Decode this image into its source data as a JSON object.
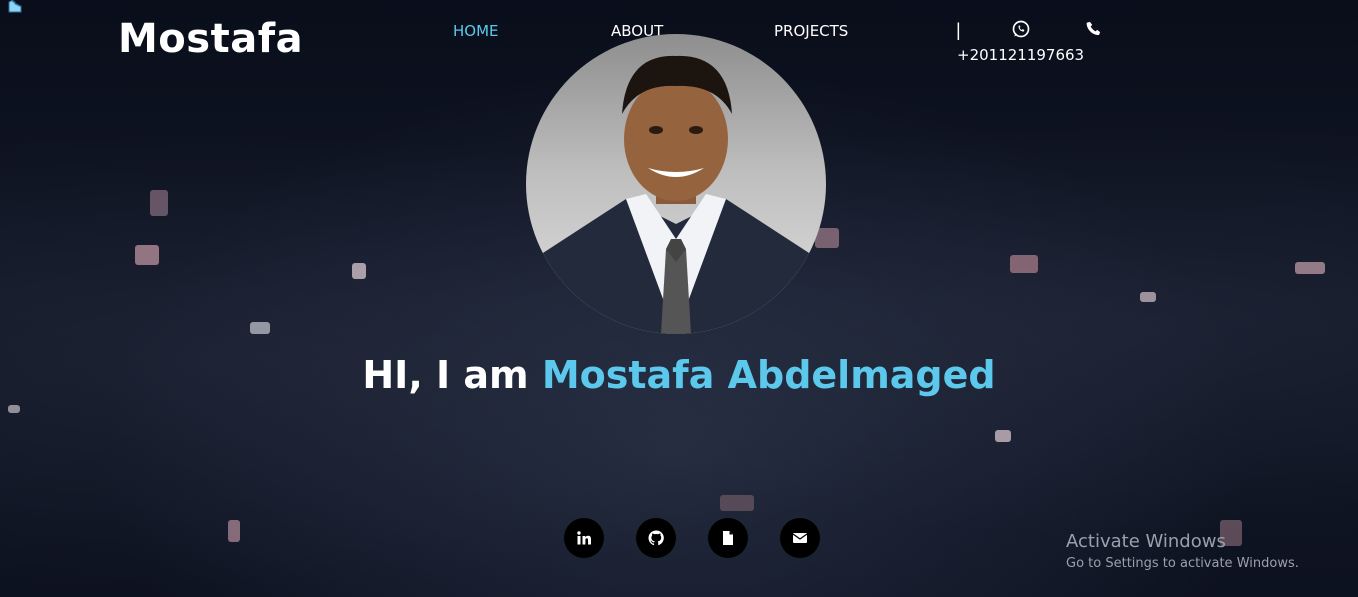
{
  "brand": {
    "name": "Mostafa"
  },
  "nav": {
    "items": [
      {
        "label": "HOME",
        "active": true
      },
      {
        "label": "ABOUT",
        "active": false
      },
      {
        "label": "PROJECTS",
        "active": false
      }
    ],
    "separator": "|",
    "phone_number": "+201121197663",
    "icons": [
      "whatsapp-icon",
      "phone-icon"
    ]
  },
  "hero": {
    "greeting": "HI, I am ",
    "name": "Mostafa Abdelmaged",
    "avatar": "portrait-photo"
  },
  "social": {
    "icons": [
      "linkedin-icon",
      "github-icon",
      "file-icon",
      "envelope-icon"
    ]
  },
  "watermark": {
    "title": "Activate Windows",
    "subtitle": "Go to Settings to activate Windows."
  },
  "colors": {
    "accent": "#5bc8ec",
    "background": "#0c111f"
  }
}
